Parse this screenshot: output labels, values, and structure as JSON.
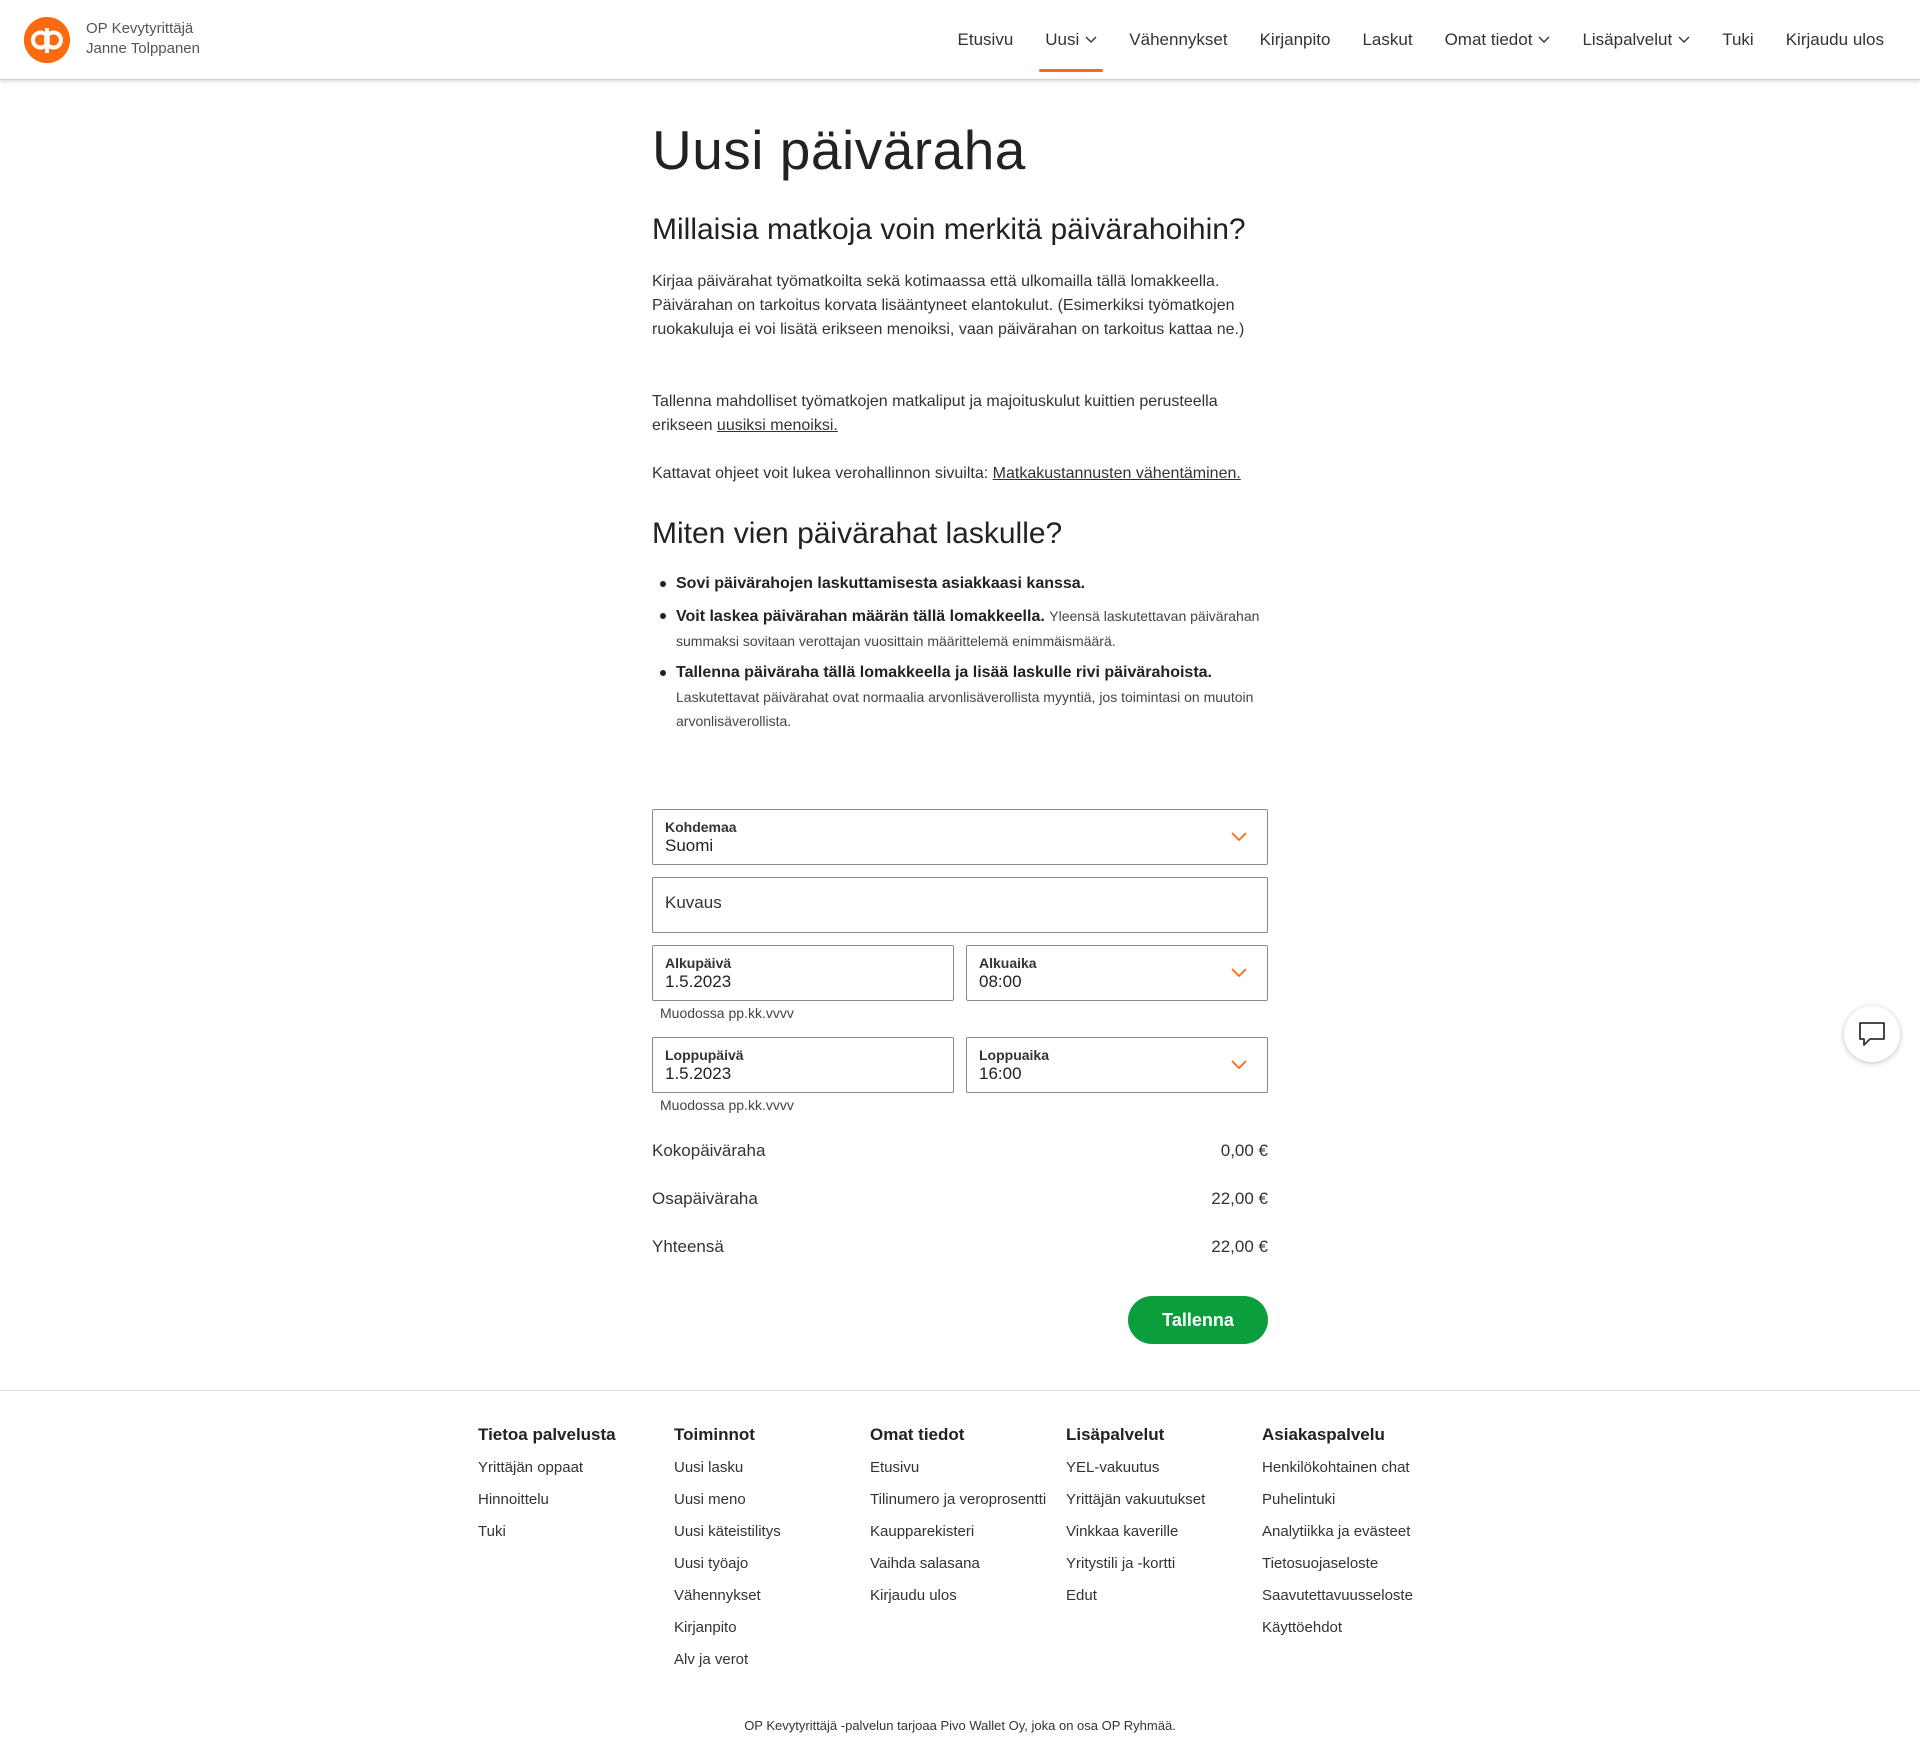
{
  "header": {
    "brand_line1": "OP Kevytyrittäjä",
    "brand_line2": "Janne Tolppanen",
    "nav": [
      {
        "label": "Etusivu",
        "dropdown": false,
        "active": false
      },
      {
        "label": "Uusi",
        "dropdown": true,
        "active": true
      },
      {
        "label": "Vähennykset",
        "dropdown": false,
        "active": false
      },
      {
        "label": "Kirjanpito",
        "dropdown": false,
        "active": false
      },
      {
        "label": "Laskut",
        "dropdown": false,
        "active": false
      },
      {
        "label": "Omat tiedot",
        "dropdown": true,
        "active": false
      },
      {
        "label": "Lisäpalvelut",
        "dropdown": true,
        "active": false
      },
      {
        "label": "Tuki",
        "dropdown": false,
        "active": false
      },
      {
        "label": "Kirjaudu ulos",
        "dropdown": false,
        "active": false
      }
    ]
  },
  "page": {
    "title": "Uusi päiväraha",
    "section1_title": "Millaisia matkoja voin merkitä päivärahoihin?",
    "p1": "Kirjaa päivärahat työmatkoilta sekä kotimaassa että ulkomailla tällä lomakkeella. Päivärahan on tarkoitus korvata lisääntyneet elantokulut. (Esimerkiksi työmatkojen ruokakuluja ei voi lisätä erikseen menoiksi, vaan päivärahan on tarkoitus kattaa ne.)",
    "p2_text": "Tallenna mahdolliset työmatkojen matkaliput ja majoituskulut kuittien perusteella erikseen ",
    "p2_link": "uusiksi menoiksi.",
    "p3_text": "Kattavat ohjeet voit lukea verohallinnon sivuilta: ",
    "p3_link": "Matkakustannusten vähentäminen.",
    "section2_title": "Miten vien päivärahat laskulle?",
    "bullets": [
      {
        "strong": "Sovi päivärahojen laskuttamisesta asiakkaasi kanssa.",
        "small": ""
      },
      {
        "strong": "Voit laskea päivärahan määrän tällä lomakkeella.",
        "small": "Yleensä laskutettavan päivärahan summaksi sovitaan verottajan vuosittain määrittelemä enimmäismäärä."
      },
      {
        "strong": "Tallenna päiväraha tällä lomakkeella ja lisää laskulle rivi päivärahoista.",
        "small": "Laskutettavat päivärahat ovat normaalia arvonlisäverollista myyntiä, jos toimintasi on muutoin arvonlisäverollista."
      }
    ]
  },
  "form": {
    "destination_label": "Kohdemaa",
    "destination_value": "Suomi",
    "description_placeholder": "Kuvaus",
    "start_date_label": "Alkupäivä",
    "start_date_value": "1.5.2023",
    "start_time_label": "Alkuaika",
    "start_time_value": "08:00",
    "date_hint": "Muodossa pp.kk.vvvv",
    "end_date_label": "Loppupäivä",
    "end_date_value": "1.5.2023",
    "end_time_label": "Loppuaika",
    "end_time_value": "16:00",
    "full_allowance_label": "Kokopäiväraha",
    "full_allowance_value": "0,00 €",
    "partial_allowance_label": "Osapäiväraha",
    "partial_allowance_value": "22,00 €",
    "total_label": "Yhteensä",
    "total_value": "22,00 €",
    "save_label": "Tallenna"
  },
  "footer": {
    "columns": [
      {
        "title": "Tietoa palvelusta",
        "links": [
          "Yrittäjän oppaat",
          "Hinnoittelu",
          "Tuki"
        ]
      },
      {
        "title": "Toiminnot",
        "links": [
          "Uusi lasku",
          "Uusi meno",
          "Uusi käteistilitys",
          "Uusi työajo",
          "Vähennykset",
          "Kirjanpito",
          "Alv ja verot"
        ]
      },
      {
        "title": "Omat tiedot",
        "links": [
          "Etusivu",
          "Tilinumero ja veroprosentti",
          "Kaupparekisteri",
          "Vaihda salasana",
          "Kirjaudu ulos"
        ]
      },
      {
        "title": "Lisäpalvelut",
        "links": [
          "YEL-vakuutus",
          "Yrittäjän vakuutukset",
          "Vinkkaa kaverille",
          "Yritystili ja -kortti",
          "Edut"
        ]
      },
      {
        "title": "Asiakaspalvelu",
        "links": [
          "Henkilökohtainen chat",
          "Puhelintuki",
          "Analytiikka ja evästeet",
          "Tietosuojaseloste",
          "Saavutettavuusseloste",
          "Käyttöehdot"
        ]
      }
    ],
    "note": "OP Kevytyrittäjä -palvelun tarjoaa Pivo Wallet Oy, joka on osa OP Ryhmää."
  },
  "colors": {
    "accent": "#ff6a10",
    "button": "#0a9e3c"
  },
  "icons": {
    "chevron": "chevron-down-icon",
    "chat": "chat-bubble-icon",
    "logo": "op-logo"
  }
}
